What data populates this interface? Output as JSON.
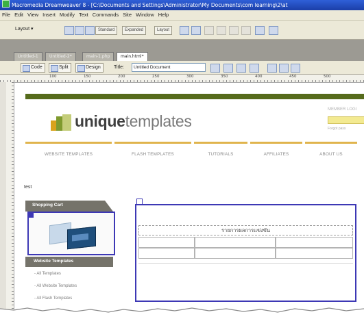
{
  "window": {
    "title": "Macromedia Dreamweaver 8 - [C:\\Documents and Settings\\Administrator\\My Documents\\com learning\\2\\at"
  },
  "menu": [
    "File",
    "Edit",
    "View",
    "Insert",
    "Modify",
    "Text",
    "Commands",
    "Site",
    "Window",
    "Help"
  ],
  "insert_bar": {
    "layout_dropdown": "Layout",
    "modes": [
      "Standard",
      "Expanded",
      "Layout"
    ]
  },
  "document_tabs": [
    "Untitled-1",
    "Untitled-2*",
    "main-1.php",
    "main.html*"
  ],
  "doc_toolbar": {
    "code": "Code",
    "split": "Split",
    "design": "Design",
    "title_label": "Title:",
    "title_value": "Untitled Document"
  },
  "ruler": {
    "ticks": [
      "100",
      "150",
      "200",
      "250",
      "300",
      "350",
      "400",
      "450",
      "500"
    ]
  },
  "page": {
    "logo_bold": "unique",
    "logo_light": "templates",
    "member_login": "MEMBER LOGI",
    "forgot": "Forgot pass",
    "nav": [
      "WEBSITE TEMPLATES",
      "FLASH TEMPLATES",
      "TUTORIALS",
      "AFFILIATES",
      "ABOUT US"
    ],
    "text_label": "test",
    "sidebar": {
      "cart_title": "Shopping Cart",
      "website_templates_title": "Website Templates",
      "links": [
        "All Templates",
        "All Website Templates",
        "All Flash Templates"
      ]
    },
    "table": {
      "header": "รายการผลการแข่งขัน"
    }
  },
  "colors": {
    "accent_green": "#566b1c",
    "nav_gold": "#e0b44d",
    "selection_blue": "#3d38b5",
    "sidebar_header": "#75736a",
    "login_field": "#f3ea91"
  }
}
